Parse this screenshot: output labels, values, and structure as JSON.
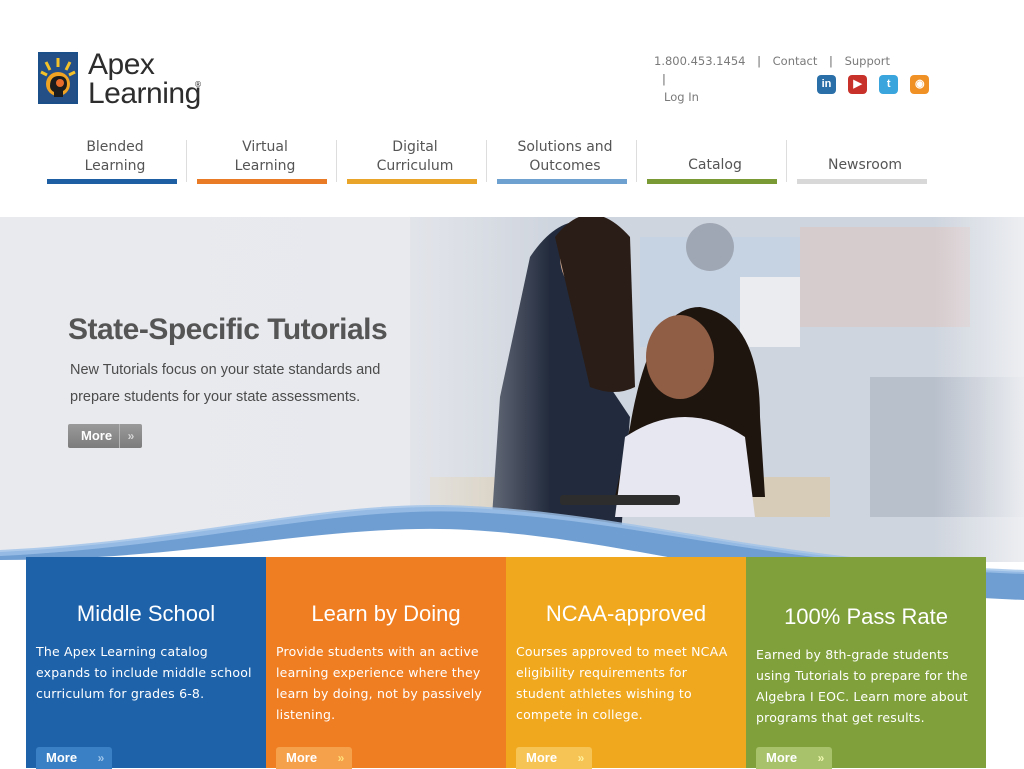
{
  "brand": {
    "name_line1": "Apex",
    "name_line2": "Learning",
    "registered": "®"
  },
  "utility_nav": {
    "phone": "1.800.453.1454",
    "contact": "Contact",
    "support": "Support",
    "login": "Log In",
    "separator": "|"
  },
  "social": [
    {
      "icon": "linkedin-icon",
      "glyph": "in",
      "color": "#2b6fa8"
    },
    {
      "icon": "youtube-icon",
      "glyph": "▶",
      "color": "#c8312a"
    },
    {
      "icon": "twitter-icon",
      "glyph": "t",
      "color": "#3aa5dd"
    },
    {
      "icon": "rss-icon",
      "glyph": "◉",
      "color": "#f09126"
    }
  ],
  "main_nav": [
    {
      "line1": "Blended",
      "line2": "Learning",
      "color": "#1e5fa4"
    },
    {
      "line1": "Virtual",
      "line2": "Learning",
      "color": "#e97a26"
    },
    {
      "line1": "Digital",
      "line2": "Curriculum",
      "color": "#e8a52a"
    },
    {
      "line1": "Solutions and",
      "line2": "Outcomes",
      "color": "#6ea0d0"
    },
    {
      "line1": "",
      "line2": "Catalog",
      "color": "#7a9a35"
    },
    {
      "line1": "",
      "line2": "Newsroom",
      "color": "#d8d8d8"
    }
  ],
  "hero": {
    "title": "State-Specific Tutorials",
    "text": "New Tutorials focus on your state standards and prepare students for your state assessments.",
    "more": "More",
    "more_arrow": "»"
  },
  "features": [
    {
      "title": "Middle School",
      "text": "The Apex Learning catalog expands to include middle school curriculum for grades 6-8.",
      "more": "More",
      "color": "#1e62aa",
      "button_color": "#3a80c4",
      "arrow_color": "#9ec4ea"
    },
    {
      "title": "Learn by Doing",
      "text": "Provide students with an active learning experience where they learn by doing, not by passively listening.",
      "more": "More",
      "color": "#ef7d22",
      "button_color": "#f5a04a",
      "arrow_color": "#ffe07a"
    },
    {
      "title": "NCAA-approved",
      "text": "Courses approved to meet NCAA eligibility requirements for student athletes wishing to compete in college.",
      "more": "More",
      "color": "#f0a81f",
      "button_color": "#f6c454",
      "arrow_color": "#fff0a0"
    },
    {
      "title": "100% Pass Rate",
      "text": "Earned by 8th-grade students using Tutorials to prepare for the Algebra I EOC. Learn more about programs that get results.",
      "more": "More",
      "color": "#7fa03a",
      "button_color": "#a7c26a",
      "arrow_color": "#eef5b0"
    }
  ]
}
